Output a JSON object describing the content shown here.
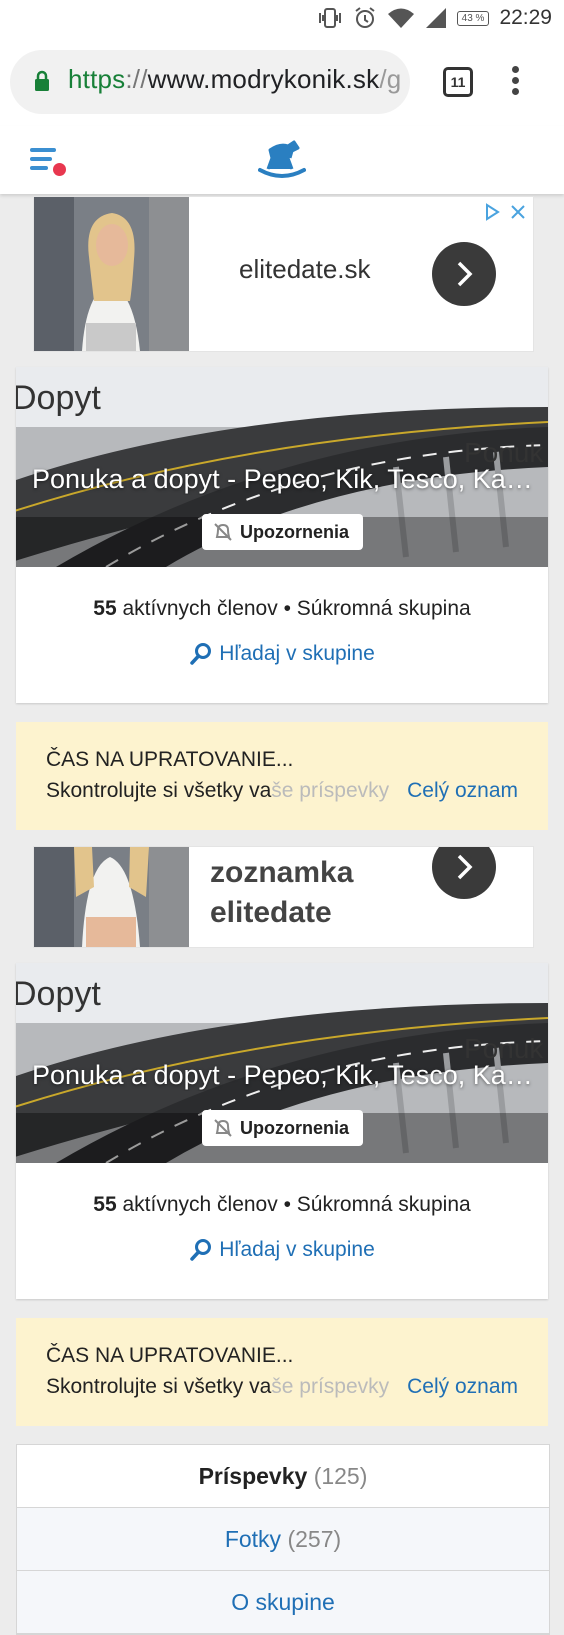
{
  "status_bar": {
    "time": "22:29",
    "battery": "43 %"
  },
  "browser": {
    "url_scheme": "https",
    "url_sep": "://",
    "url_host": "www.modrykonik.sk",
    "url_path": "/g",
    "tab_count": "11"
  },
  "ads": [
    {
      "text": "elitedate.sk"
    },
    {
      "text_line1": "zoznamka",
      "text_line2": "elitedate"
    }
  ],
  "group_cards": [
    {
      "banner_word_left": "Dopyt",
      "banner_word_right": "Ponuk",
      "title": "Ponuka a dopyt - Pepco, Kik, Tesco, Kaufland, Lidl...",
      "notify_label": "Upozornenia",
      "members_count": "55",
      "members_text": " aktívnych členov • Súkromná skupina",
      "search_label": "Hľadaj v skupine"
    },
    {
      "banner_word_left": "Dopyt",
      "banner_word_right": "Ponuk",
      "title": "Ponuka a dopyt - Pepco, Kik, Tesco, Kaufland, Lidl...",
      "notify_label": "Upozornenia",
      "members_count": "55",
      "members_text": " aktívnych členov • Súkromná skupina",
      "search_label": "Hľadaj v skupine"
    }
  ],
  "notices": [
    {
      "title": "ČAS NA UPRATOVANIE...",
      "body": "Skontrolujte si všetky va",
      "body_fade": "še príspevky",
      "more": "Celý oznam"
    },
    {
      "title": "ČAS NA UPRATOVANIE...",
      "body": "Skontrolujte si všetky va",
      "body_fade": "še príspevky",
      "more": "Celý oznam"
    }
  ],
  "tabs": [
    {
      "label": "Príspevky",
      "count": "(125)"
    },
    {
      "label": "Fotky",
      "count": "(257)"
    },
    {
      "label": "O skupine",
      "count": ""
    }
  ],
  "colors": {
    "accent": "#1f6fb5",
    "notice_bg": "#fdf3cf",
    "menu_dot": "#e8374f",
    "logo": "#2a7fc1"
  }
}
